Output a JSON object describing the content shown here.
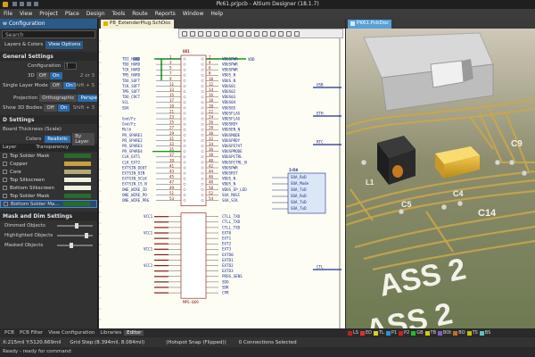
{
  "window": {
    "title": "Pk61.prjpcb - Altium Designer (18.1.7)"
  },
  "menu": [
    "File",
    "View",
    "Project",
    "Place",
    "Design",
    "Tools",
    "Route",
    "Reports",
    "Window",
    "Help"
  ],
  "left_panel": {
    "title": "w Configuration",
    "search_placeholder": "Search",
    "tabs": [
      "Layers & Colors",
      "View Options"
    ],
    "general_settings": {
      "heading": "General Settings",
      "configuration_label": "Configuration",
      "configuration_value": "[",
      "view_mode_label": "3D",
      "off": "Off",
      "on": "On",
      "shortcut_2or3": "2 or 3",
      "single_layer_label": "Single Layer Mode",
      "shortcut_shift_s": "Shift + S",
      "projection_label": "Projection",
      "projection_orthographic": "Orthographic",
      "projection_perspective": "Perspective",
      "show_3d_bodies_label": "Show 3D Bodies",
      "shortcut_shift_ctrl3": "Shift + 3"
    },
    "d_settings": {
      "heading": "D Settings",
      "board_thickness_label": "Board Thickness (Scale)",
      "colors_label": "Colors",
      "colors_realistic": "Realistic",
      "colors_by_layer": "By Layer"
    },
    "layers": {
      "col_layer": "Layer",
      "col_transparency": "Transparency",
      "items": [
        {
          "name": "Top Solder Mask",
          "color": "#2a6a2a"
        },
        {
          "name": "Copper",
          "color": "#c8a040"
        },
        {
          "name": "Core",
          "color": "#b4a878"
        },
        {
          "name": "Top Silkscreen",
          "color": "#f0f0e0"
        },
        {
          "name": "Bottom Silkscreen",
          "color": "#f0f0e0"
        },
        {
          "name": "Top Solder Mask",
          "color": "#2a6a2a"
        },
        {
          "name": "Bottom Solder Ma...",
          "color": "#2a6a2a"
        }
      ]
    },
    "mask_settings": {
      "heading": "Mask and Dim Settings",
      "items": [
        {
          "label": "Dimmed Objects",
          "level": 0.55
        },
        {
          "label": "Highlighted Objects",
          "level": 0.85
        },
        {
          "label": "Masked Objects",
          "level": 0.4
        }
      ]
    }
  },
  "schematic": {
    "tab_label": "P8_ExtenderPlug.SchDoc",
    "ic_designator": "U81",
    "ic_part": "MPS-069",
    "net_top_left": "GND",
    "net_top_right": "VDD",
    "left_pins": [
      {
        "num": "1",
        "name": "TDI_HARD"
      },
      {
        "num": "3",
        "name": "TDO_HARD"
      },
      {
        "num": "5",
        "name": "TCK_HARD"
      },
      {
        "num": "7",
        "name": "TMS_HARD"
      },
      {
        "num": "9",
        "name": "TDO_SOFT"
      },
      {
        "num": "11",
        "name": "TCK_SOFT"
      },
      {
        "num": "13",
        "name": "TMS_SOFT"
      },
      {
        "num": "15",
        "name": "TDO_CRCT"
      },
      {
        "num": "17",
        "name": "SCL"
      },
      {
        "num": "19",
        "name": "SDA"
      },
      {
        "num": "21",
        "name": ""
      },
      {
        "num": "23",
        "name": "Gnd/Fz"
      },
      {
        "num": "25",
        "name": "Gnd/Fz"
      },
      {
        "num": "27",
        "name": "Mclk"
      },
      {
        "num": "29",
        "name": "PR_SPARE1"
      },
      {
        "num": "31",
        "name": "PR_SPARE2"
      },
      {
        "num": "33",
        "name": "PR_SPARE3"
      },
      {
        "num": "35",
        "name": "PR_SPARE4"
      },
      {
        "num": "37",
        "name": "CLK_EXT1"
      },
      {
        "num": "39",
        "name": "CLK_EXT2"
      },
      {
        "num": "41",
        "name": "EXTSIN_DOUT"
      },
      {
        "num": "43",
        "name": "EXTSIN_DIN"
      },
      {
        "num": "45",
        "name": "EXTSIN_SCLK"
      },
      {
        "num": "47",
        "name": "EXTSIN_CS_N"
      },
      {
        "num": "49",
        "name": "ONE_WIRE_ID"
      },
      {
        "num": "51",
        "name": "ONE_WIRE_PO"
      },
      {
        "num": "53",
        "name": "ONE_WIRE_PRG"
      }
    ],
    "right_pins": [
      {
        "num": "2",
        "name": "VBUSPWR"
      },
      {
        "num": "4",
        "name": "VBUSPWR"
      },
      {
        "num": "6",
        "name": "VBUSPWR"
      },
      {
        "num": "8",
        "name": "VBUS_N"
      },
      {
        "num": "10",
        "name": "VBUS_N"
      },
      {
        "num": "12",
        "name": "VBUS01"
      },
      {
        "num": "14",
        "name": "VBUS02"
      },
      {
        "num": "16",
        "name": "VBUS03"
      },
      {
        "num": "18",
        "name": "VBUS04"
      },
      {
        "num": "20",
        "name": "VBUS05"
      },
      {
        "num": "22",
        "name": "VBUSFLAG"
      },
      {
        "num": "24",
        "name": "VBUSFLAG"
      },
      {
        "num": "26",
        "name": "VBUSRDY"
      },
      {
        "num": "28",
        "name": "VBUSEN_N"
      },
      {
        "num": "30",
        "name": "VBUSMODE"
      },
      {
        "num": "32",
        "name": "VBUSPRDY"
      },
      {
        "num": "34",
        "name": "VBUSPSTAT"
      },
      {
        "num": "36",
        "name": "VBUSPMODE"
      },
      {
        "num": "38",
        "name": "VBUSPCTRL"
      },
      {
        "num": "40",
        "name": "VBUSPCTRL_N"
      },
      {
        "num": "42",
        "name": "VBUSPWR"
      },
      {
        "num": "44",
        "name": "VBUSRST"
      },
      {
        "num": "46",
        "name": "VBUS_N"
      },
      {
        "num": "48",
        "name": "VBUS_N"
      },
      {
        "num": "50",
        "name": "VBUS_EP_LED"
      },
      {
        "num": "52",
        "name": "SOA_MOSI"
      },
      {
        "num": "54",
        "name": "SOA_SCK"
      }
    ],
    "bottom_left_nets": [
      "VCC1",
      "VCC1",
      "VCC1",
      "VCC1"
    ],
    "bottom_right_pins": [
      "CTLL_TXD",
      "CTLL_TXD",
      "CTLL_TXD",
      "EXT0",
      "EXT1",
      "EXT2",
      "EXT3",
      "EXTD0",
      "EXTD1",
      "EXTD2",
      "EXTD3",
      "PROG_SENS",
      "SDO",
      "SDK",
      "CPR"
    ],
    "harness_title": "IrDA",
    "harness_entries": [
      "SOA_RxD",
      "SOA_Mode",
      "SOA_TxD",
      "SOA_RxD",
      "SOA_TxD",
      "SOA_TxD"
    ],
    "net_labels_right": [
      "USB",
      "ETH",
      "RTC",
      "CTL"
    ]
  },
  "pcb": {
    "tab_label": "PK61.PcbDoc",
    "silk_labels": [
      "L1",
      "C4",
      "C5",
      "C14",
      "C9",
      "ASS 2",
      "ASS 2"
    ]
  },
  "layer_tabs": [
    {
      "label": "LS",
      "color": "#c02020"
    },
    {
      "label": "ED",
      "color": "#e03030"
    },
    {
      "label": "TL",
      "color": "#d8d020"
    },
    {
      "label": "P1",
      "color": "#3090d0"
    },
    {
      "label": "P2",
      "color": "#d02020"
    },
    {
      "label": "GB",
      "color": "#20c020"
    },
    {
      "label": "TB",
      "color": "#d0d000"
    },
    {
      "label": "BOt",
      "color": "#8060c0"
    },
    {
      "label": "BO",
      "color": "#c07030"
    },
    {
      "label": "TS",
      "color": "#c0c000"
    },
    {
      "label": "BS",
      "color": "#60c0c0"
    }
  ],
  "bottom_tabs": [
    "PCB",
    "PCB Filter",
    "View Configuration",
    "Libraries",
    "Editor"
  ],
  "statusbar": {
    "coords": "X:215mil Y:5120.669mil",
    "grid": "Grid Step:(8.394mil, 8.084mil)",
    "snap": "(Hotspot Snap (Flipped))",
    "connections": "0 Connections Selected"
  },
  "ready_text": "Ready - ready for command"
}
